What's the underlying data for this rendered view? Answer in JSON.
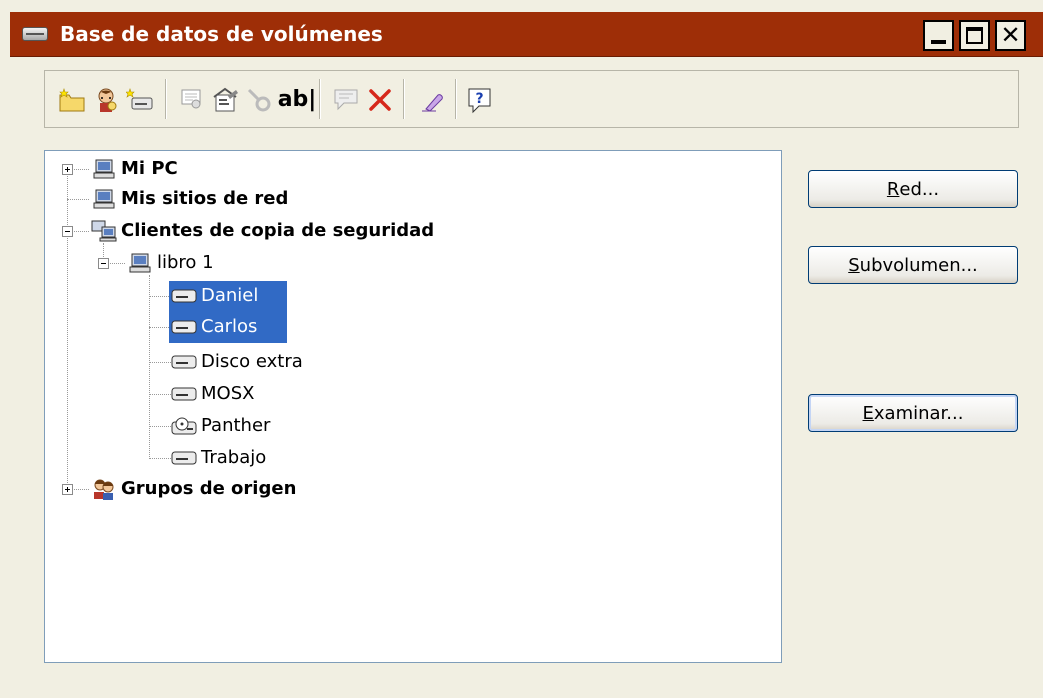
{
  "window": {
    "title": "Base de datos de volúmenes",
    "close_glyph": "✕"
  },
  "toolbar": {
    "rename_label": "ab|"
  },
  "tree": {
    "my_pc": "Mi PC",
    "network_places": "Mis sitios de red",
    "backup_clients": "Clientes de copia de seguridad",
    "book1": "libro 1",
    "daniel": "Daniel",
    "carlos": "Carlos",
    "extra_disk": "Disco extra",
    "mosx": "MOSX",
    "panther": "Panther",
    "work": "Trabajo",
    "source_groups": "Grupos de origen"
  },
  "buttons": {
    "network_key": "R",
    "network_rest": "ed...",
    "subvolume_key": "S",
    "subvolume_rest": "ubvolumen...",
    "browse_key": "E",
    "browse_rest": "xaminar..."
  },
  "colors": {
    "titlebar": "#9e2e07",
    "selection": "#316ac5",
    "tree_border": "#7f9db9"
  }
}
